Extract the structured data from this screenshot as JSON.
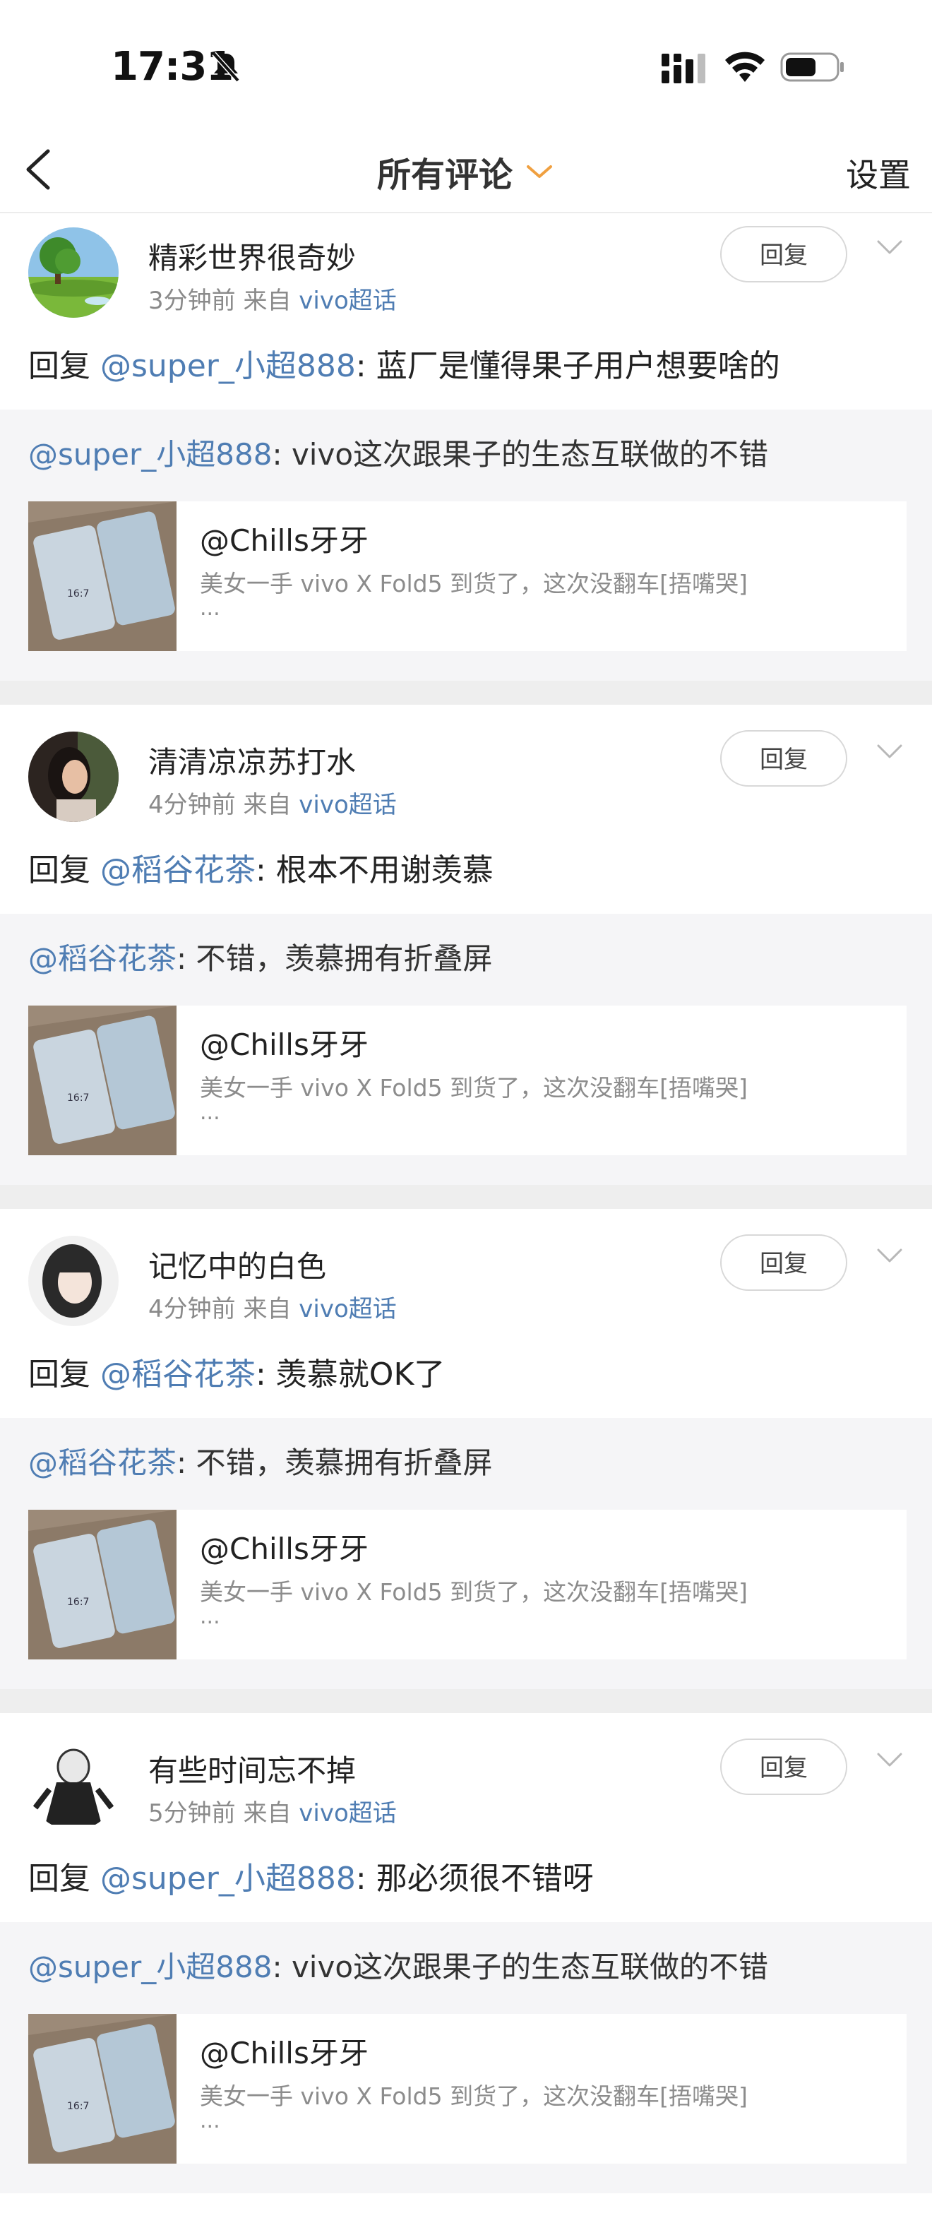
{
  "status_bar": {
    "time": "17:31",
    "icons": [
      "bell-muted-icon",
      "cellular-signal-icon",
      "wifi-icon",
      "battery-icon"
    ]
  },
  "nav": {
    "title": "所有评论",
    "settings": "设置",
    "accent_color": "#f0a040"
  },
  "colors": {
    "link": "#4f7db3",
    "meta": "#8a8a8a",
    "quote_bg": "#f5f5f7",
    "separator": "#eeeeee"
  },
  "comments": [
    {
      "name": "精彩世界很奇妙",
      "time": "3分钟前",
      "source_prefix": "来自",
      "source": "vivo超话",
      "reply_button": "回复",
      "reply_prefix": "回复",
      "reply_mention": "@super_小超888",
      "reply_body": ": 蓝厂是懂得果子用户想要啥的",
      "quote_mention": "@super_小超888",
      "quote_body": ": vivo这次跟果子的生态互联做的不错",
      "card_author": "@Chills牙牙",
      "card_desc": "美女一手 vivo X Fold5 到货了，这次没翻车[捂嘴哭]",
      "card_more": "..."
    },
    {
      "name": "清清凉凉苏打水",
      "time": "4分钟前",
      "source_prefix": "来自",
      "source": "vivo超话",
      "reply_button": "回复",
      "reply_prefix": "回复",
      "reply_mention": "@稻谷花茶",
      "reply_body": ": 根本不用谢羡慕",
      "quote_mention": "@稻谷花茶",
      "quote_body": ": 不错，羡慕拥有折叠屏",
      "card_author": "@Chills牙牙",
      "card_desc": "美女一手 vivo X Fold5 到货了，这次没翻车[捂嘴哭]",
      "card_more": "..."
    },
    {
      "name": "记忆中的白色",
      "time": "4分钟前",
      "source_prefix": "来自",
      "source": "vivo超话",
      "reply_button": "回复",
      "reply_prefix": "回复",
      "reply_mention": "@稻谷花茶",
      "reply_body": ": 羡慕就OK了",
      "quote_mention": "@稻谷花茶",
      "quote_body": ": 不错，羡慕拥有折叠屏",
      "card_author": "@Chills牙牙",
      "card_desc": "美女一手 vivo X Fold5 到货了，这次没翻车[捂嘴哭]",
      "card_more": "..."
    },
    {
      "name": "有些时间忘不掉",
      "time": "5分钟前",
      "source_prefix": "来自",
      "source": "vivo超话",
      "reply_button": "回复",
      "reply_prefix": "回复",
      "reply_mention": "@super_小超888",
      "reply_body": ": 那必须很不错呀",
      "quote_mention": "@super_小超888",
      "quote_body": ": vivo这次跟果子的生态互联做的不错",
      "card_author": "@Chills牙牙",
      "card_desc": "美女一手 vivo X Fold5 到货了，这次没翻车[捂嘴哭]",
      "card_more": "..."
    }
  ]
}
